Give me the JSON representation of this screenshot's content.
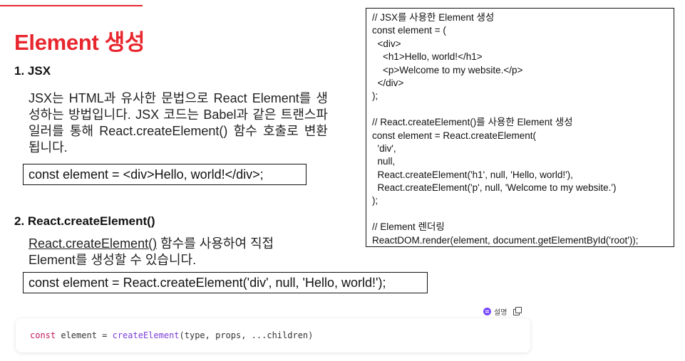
{
  "header": {
    "cut_text": "",
    "title": "Element 생성"
  },
  "section1": {
    "heading": "1. JSX",
    "paragraph": "JSX는 HTML과 유사한 문법으로 React Element를 생성하는 방법입니다. JSX 코드는 Babel과 같은 트랜스파일러를 통해 React.createElement() 함수 호출로 변환됩니다.",
    "code": "const element = <div>Hello, world!</div>;"
  },
  "section2": {
    "heading": "2. React.createElement()",
    "paragraph_link": "React.createElement()",
    "paragraph_rest": " 함수를 사용하여 직접 Element를 생성할 수 있습니다.",
    "code": "const element = React.createElement('div', null, 'Hello, world!');"
  },
  "code_panel": {
    "lines": [
      "// JSX를 사용한 Element 생성",
      "const element = (",
      "  <div>",
      "    <h1>Hello, world!</h1>",
      "    <p>Welcome to my website.</p>",
      "  </div>",
      ");",
      "",
      "// React.createElement()를 사용한 Element 생성",
      "const element = React.createElement(",
      "  'div',",
      "  null,",
      "  React.createElement('h1', null, 'Hello, world!'),",
      "  React.createElement('p', null, 'Welcome to my website.')",
      ");",
      "",
      "// Element 렌더링",
      "ReactDOM.render(element, document.getElementById('root'));"
    ]
  },
  "snippet": {
    "toolbar": {
      "explain_label": "설명",
      "explain_icon": "ai-sparkle-icon",
      "copy_icon": "copy-icon"
    },
    "keyword": "const",
    "middle": " element = ",
    "function": "createElement",
    "args": "(type, props, ...children)"
  },
  "colors": {
    "accent": "#e8262e",
    "keyword": "#c2185b",
    "function": "#7a3ed8",
    "ai": "#7b4dff"
  }
}
